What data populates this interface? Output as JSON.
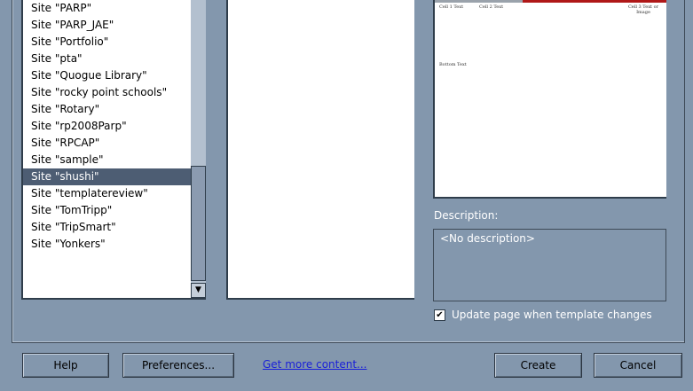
{
  "site_list": {
    "items": [
      "Site \"PARP\"",
      "Site \"PARP_JAE\"",
      "Site \"Portfolio\"",
      "Site \"pta\"",
      "Site \"Quogue Library\"",
      "Site \"rocky point schools\"",
      "Site \"Rotary\"",
      "Site \"rp2008Parp\"",
      "Site \"RPCAP\"",
      "Site \"sample\"",
      "Site \"shushi\"",
      "Site \"templatereview\"",
      "Site \"TomTripp\"",
      "Site \"TripSmart\"",
      "Site \"Yonkers\""
    ],
    "selected_index": 10,
    "scroll_down_icon": "triangle-down"
  },
  "preview": {
    "cell1": "Cell 1 Text",
    "cell2": "Cell 2 Text",
    "cell3": "Cell 3 Text or Image",
    "bottom": "Bottom Text"
  },
  "description": {
    "label": "Description:",
    "value": "<No description>"
  },
  "update_checkbox": {
    "label": "Update page when template changes",
    "checked": true
  },
  "buttons": {
    "help": "Help",
    "preferences": "Preferences...",
    "get_more_content": "Get more content...",
    "create": "Create",
    "cancel": "Cancel"
  },
  "colors": {
    "selection_bg": "#4d5d73",
    "panel_bg": "#8397ad",
    "link": "#1a20d8",
    "preview_accent": "#b01818"
  }
}
